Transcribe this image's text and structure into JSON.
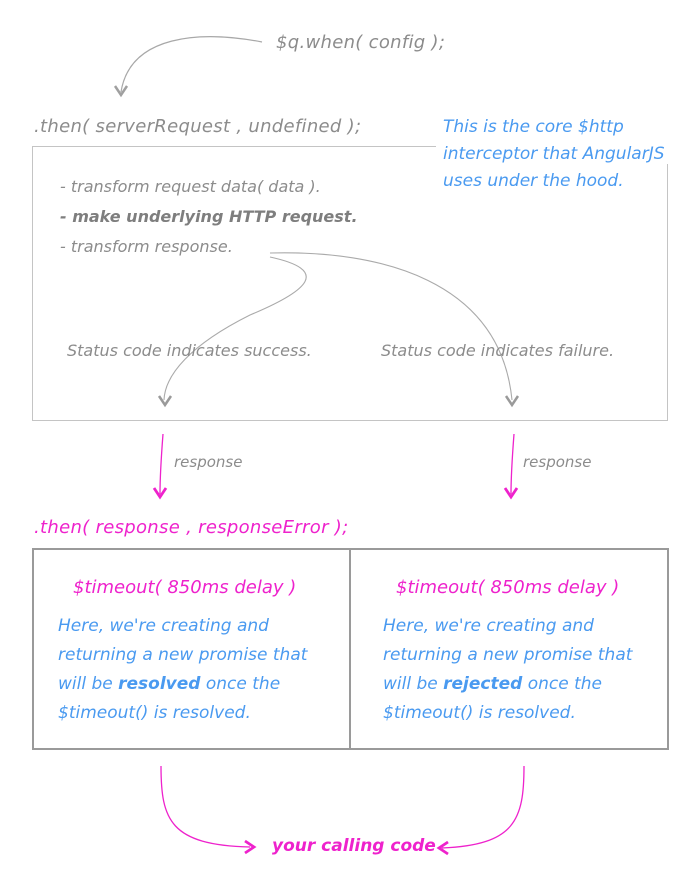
{
  "start": {
    "label": "$q.when( config );"
  },
  "step1": {
    "label": ".then( serverRequest , undefined );",
    "note": [
      "This is the core $http",
      "interceptor that AngularJS",
      "uses under the hood."
    ],
    "items": [
      {
        "text": "- transform request data( data )."
      },
      {
        "text": "- make underlying HTTP request."
      },
      {
        "text": "- transform response."
      }
    ],
    "success_label": "Status code indicates success.",
    "failure_label": "Status code indicates failure."
  },
  "edges": {
    "left_label": "response",
    "right_label": "response"
  },
  "step2": {
    "label": ".then( response , responseError );",
    "left": {
      "title": "$timeout( 850ms delay )",
      "line1": "Here, we're creating and",
      "line2": "returning a new promise that",
      "line3_pre": "will be ",
      "line3_bold": "resolved",
      "line3_post": " once the",
      "line4": "$timeout() is resolved."
    },
    "right": {
      "title": "$timeout( 850ms delay )",
      "line1": "Here, we're creating and",
      "line2": "returning a new promise that",
      "line3_pre": "will be ",
      "line3_bold": "rejected",
      "line3_post": " once the",
      "line4": "$timeout() is resolved."
    }
  },
  "end": {
    "label": "your calling code"
  },
  "colors": {
    "gray": "#8c8c8c",
    "pink": "#ee22cc",
    "blue": "#4a9af0",
    "box_border": "#c4c4c4",
    "box2_border": "#9a9a9a"
  }
}
